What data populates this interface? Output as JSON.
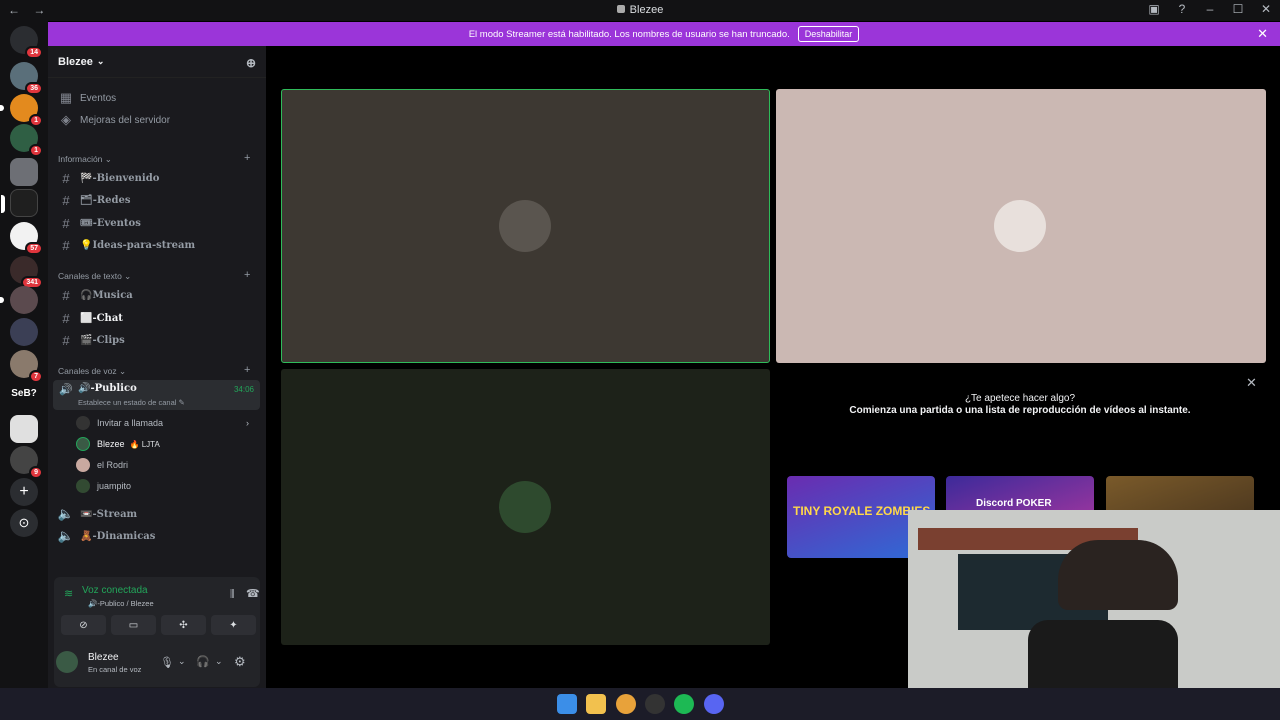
{
  "titlebar": {
    "title": "Blezee",
    "back": "←",
    "forward": "→"
  },
  "banner": {
    "text": "El modo Streamer está habilitado. Los nombres de usuario se han truncado.",
    "button": "Deshabilitar",
    "close": "✕"
  },
  "guild_badges": [
    "14",
    "36",
    "1",
    "1",
    "57",
    "341",
    "7",
    "9"
  ],
  "guild_label": "SeB?",
  "server": {
    "name": "Blezee",
    "items": [
      {
        "label": "Eventos"
      },
      {
        "label": "Mejoras del servidor"
      }
    ],
    "categories": {
      "info": "Información",
      "text": "Canales de texto",
      "voice": "Canales de voz"
    },
    "info_channels": [
      "🏁-Bienvenido",
      "🗂-Redes",
      "🎟-Eventos",
      "💡Ideas-para-stream"
    ],
    "text_channels": [
      "🎧Musica",
      "⬜-Chat",
      "🎬-Clips"
    ],
    "voice": {
      "active_channel": "🔊-Publico",
      "timer": "34:06",
      "status_hint": "Establece un estado de canal ✎",
      "invite": "Invitar a llamada",
      "members": [
        "Blezee",
        "el Rodri",
        "juampito"
      ],
      "member_tag": "🔥 LJTA",
      "other_channels": [
        "📼-Stream",
        "🧸-Dinamicas"
      ]
    }
  },
  "voice_panel": {
    "status": "Voz conectada",
    "channel": "🔊-Publico / Blezee"
  },
  "user": {
    "name": "Blezee",
    "status": "En canal de voz"
  },
  "activity": {
    "line1": "¿Te apetece hacer algo?",
    "line2": "Comienza una partida o una lista de reproducción de vídeos al instante.",
    "games": [
      "TINY ROYALE ZOMBIES",
      "Discord POKER",
      ""
    ]
  },
  "colors": {
    "accent": "#9b35d9",
    "green": "#23a55a",
    "badge": "#e0353d"
  }
}
